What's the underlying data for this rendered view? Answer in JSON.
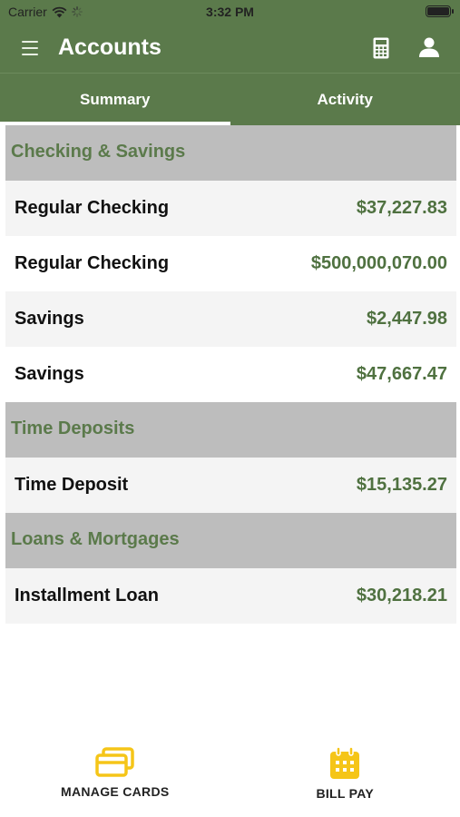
{
  "status_bar": {
    "carrier": "Carrier",
    "time": "3:32 PM"
  },
  "header": {
    "title": "Accounts"
  },
  "tabs": [
    {
      "label": "Summary",
      "active": true
    },
    {
      "label": "Activity",
      "active": false
    }
  ],
  "sections": [
    {
      "title": "Checking & Savings",
      "accounts": [
        {
          "name": "Regular Checking",
          "amount": "$37,227.83"
        },
        {
          "name": "Regular Checking",
          "amount": "$500,000,070.00"
        },
        {
          "name": "Savings",
          "amount": "$2,447.98"
        },
        {
          "name": "Savings",
          "amount": "$47,667.47"
        }
      ]
    },
    {
      "title": "Time Deposits",
      "accounts": [
        {
          "name": "Time Deposit",
          "amount": "$15,135.27"
        }
      ]
    },
    {
      "title": "Loans & Mortgages",
      "accounts": [
        {
          "name": "Installment Loan",
          "amount": "$30,218.21"
        }
      ]
    }
  ],
  "bottom_nav": {
    "manage_cards": "MANAGE CARDS",
    "bill_pay": "BILL PAY"
  },
  "colors": {
    "brand_green": "#5b7a4b",
    "amount_green": "#4f7140",
    "section_gray": "#bdbdbd",
    "icon_yellow": "#f5c518"
  },
  "icons": [
    "menu-icon",
    "calculator-icon",
    "user-icon",
    "wifi-icon",
    "activity-spinner-icon",
    "battery-icon",
    "credit-cards-icon",
    "calendar-icon"
  ]
}
